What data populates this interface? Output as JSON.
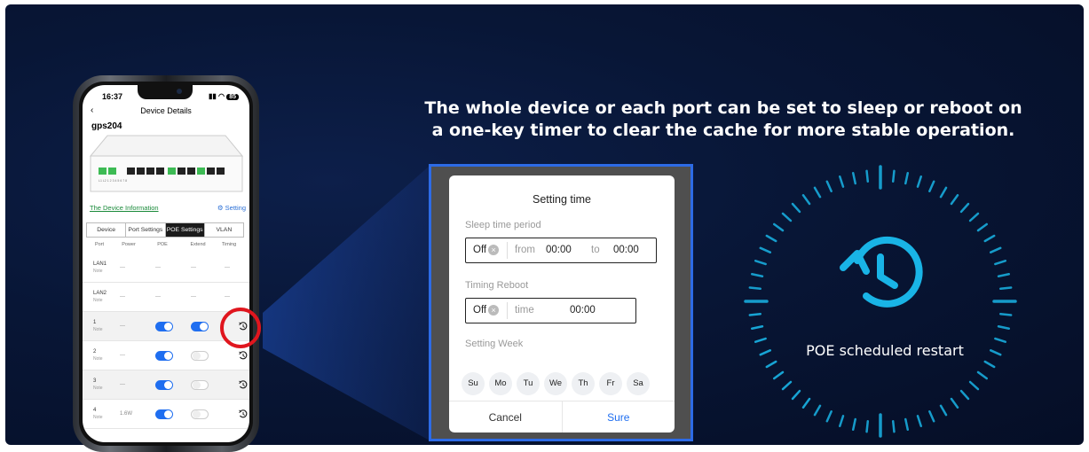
{
  "headline": {
    "line1": "The whole device or each port can be set to sleep or reboot on",
    "line2": "a one-key timer to clear the cache for more stable operation."
  },
  "phone": {
    "time": "16:37",
    "battery": "85",
    "nav_title": "Device Details",
    "device_name": "gps204",
    "info_link": "The Device Information",
    "setting_link": "Setting",
    "tabs": [
      "Device",
      "Port Settings",
      "POE Settings",
      "VLAN"
    ],
    "active_tab": "POE Settings",
    "columns": [
      "Port",
      "Power",
      "POE",
      "Extend",
      "Timing"
    ],
    "rows": [
      {
        "port": "LAN1",
        "note": "Note",
        "power": "---",
        "poe": "---",
        "extend": "---",
        "timing": "---"
      },
      {
        "port": "LAN2",
        "note": "Note",
        "power": "---",
        "poe": "---",
        "extend": "---",
        "timing": "---"
      },
      {
        "port": "1",
        "note": "Note",
        "power": "---",
        "poe_on": true,
        "extend_on": true
      },
      {
        "port": "2",
        "note": "Note",
        "power": "---",
        "poe_on": true,
        "extend_on": false
      },
      {
        "port": "3",
        "note": "Note",
        "power": "---",
        "poe_on": true,
        "extend_on": false
      },
      {
        "port": "4",
        "note": "Note",
        "power": "1.6W",
        "poe_on": true,
        "extend_on": false
      }
    ]
  },
  "dialog": {
    "title": "Setting time",
    "sleep_label": "Sleep time period",
    "off_text": "Off",
    "from_text": "from",
    "from_value": "00:00",
    "to_text": "to",
    "to_value": "00:00",
    "reboot_label": "Timing Reboot",
    "time_text": "time",
    "time_value": "00:00",
    "week_label": "Setting Week",
    "days": [
      "Su",
      "Mo",
      "Tu",
      "We",
      "Th",
      "Fr",
      "Sa"
    ],
    "cancel": "Cancel",
    "sure": "Sure"
  },
  "dial": {
    "label": "POE scheduled restart"
  },
  "colors": {
    "background": "#081636",
    "accent": "#19b4e6",
    "toggle_on": "#1f6ef0",
    "highlight_ring": "#e0161e"
  }
}
